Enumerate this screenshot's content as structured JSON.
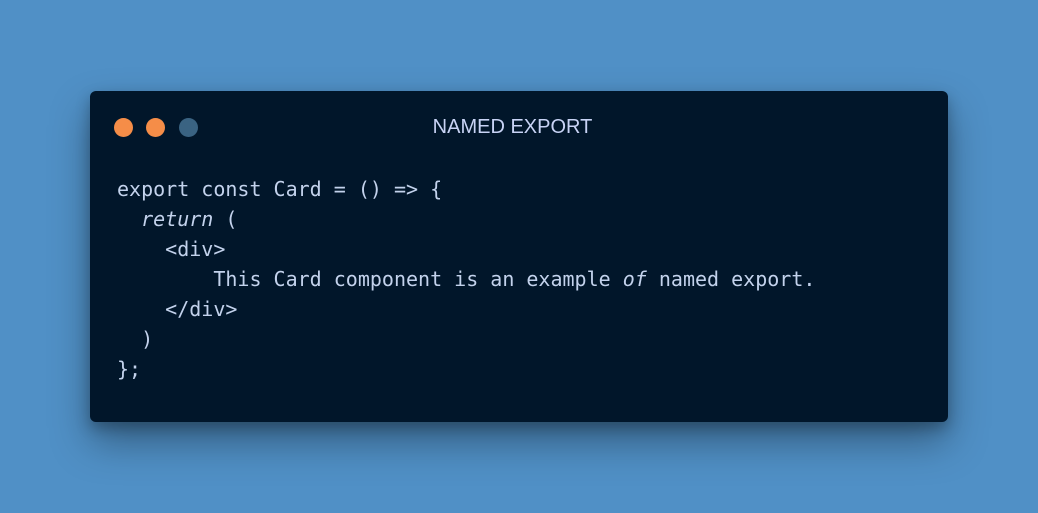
{
  "window": {
    "title": "NAMED EXPORT",
    "controls": {
      "close_color": "#f58d48",
      "minimize_color": "#f58d48",
      "maximize_color": "#3a6382"
    }
  },
  "code": {
    "language": "jsx",
    "lines": [
      "export const Card = () => {",
      "  return (",
      "    <div>",
      "        This Card component is an example of named export.",
      "    </div>",
      "  )",
      "};"
    ],
    "italic_tokens": {
      "return": "return",
      "of": "of"
    },
    "line_2_indent": "  ",
    "line_2_rest": " (",
    "line_4_before": "        This Card component is an example ",
    "line_4_after": " named export."
  },
  "colors": {
    "background": "#5090c6",
    "editor_background": "#01162a",
    "title_text": "#c8d3f5",
    "code_text": "#c3d2ec"
  }
}
